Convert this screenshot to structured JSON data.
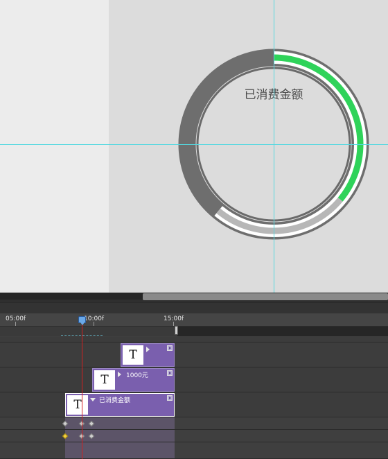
{
  "canvas": {
    "gauge_title": "已消费金额",
    "progress_fraction": 0.36,
    "colors": {
      "background": "#dcdcdc",
      "left_panel": "#ececec",
      "ring_dark": "#6e6e6e",
      "ring_light": "#ffffff",
      "progress_green": "#2fd35a",
      "remaining_gray": "#b7b7b7",
      "guide": "#55d8e0"
    }
  },
  "timeline": {
    "ruler": {
      "labels": [
        "05:00f",
        "10:00f",
        "15:00f"
      ]
    },
    "layers": [
      {
        "thumb": "T",
        "label": "",
        "icon": "text-layer-icon"
      },
      {
        "thumb": "T",
        "label": "1000元",
        "icon": "text-layer-icon"
      },
      {
        "thumb": "T",
        "label": "已消费金额",
        "icon": "text-layer-icon",
        "selected": true
      }
    ],
    "colors": {
      "layer_bar": "#7a5fae",
      "playhead": "#d42020",
      "keyframe": "#cfcfcf",
      "keyframe_selected": "#f0d040"
    }
  }
}
